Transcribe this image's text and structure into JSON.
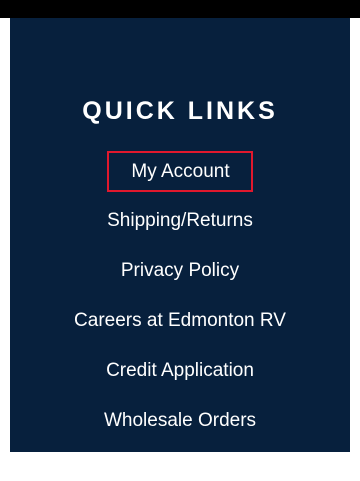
{
  "footer": {
    "heading": "QUICK LINKS",
    "links": [
      {
        "label": "My Account"
      },
      {
        "label": "Shipping/Returns"
      },
      {
        "label": "Privacy Policy"
      },
      {
        "label": "Careers at Edmonton RV"
      },
      {
        "label": "Credit Application"
      },
      {
        "label": "Wholesale Orders"
      }
    ]
  },
  "colors": {
    "panel_background": "#07203d",
    "top_strip": "#000000",
    "page_background": "#ffffff",
    "text": "#ffffff",
    "focus_outline": "#e0182d"
  }
}
